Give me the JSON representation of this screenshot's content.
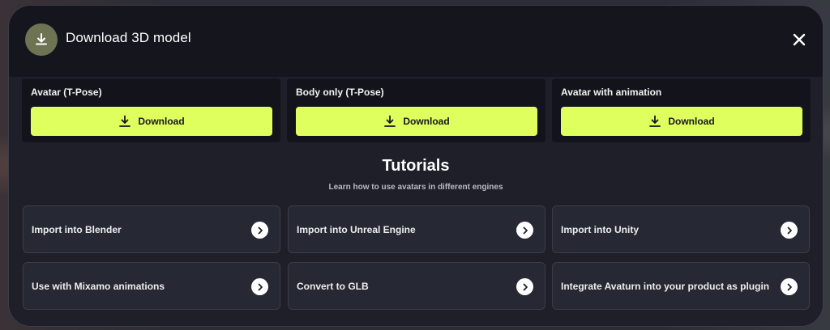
{
  "modal": {
    "title": "Download 3D model",
    "header_icon": "download-icon",
    "close_icon": "close-icon"
  },
  "downloads": [
    {
      "label": "Avatar (T-Pose)",
      "button": "Download"
    },
    {
      "label": "Body only (T-Pose)",
      "button": "Download"
    },
    {
      "label": "Avatar with animation",
      "button": "Download"
    }
  ],
  "tutorials": {
    "title": "Tutorials",
    "subtitle": "Learn how to use avatars in different engines",
    "items": [
      {
        "label": "Import into Blender"
      },
      {
        "label": "Import into Unreal Engine"
      },
      {
        "label": "Import into Unity"
      },
      {
        "label": "Use with Mixamo animations"
      },
      {
        "label": "Convert to GLB"
      },
      {
        "label": "Integrate Avaturn into your product as plugin"
      }
    ]
  },
  "colors": {
    "accent": "#deff5e",
    "modal_bg": "#1e1f29",
    "header_bg": "#14151d",
    "icon_badge": "#6e7453"
  }
}
